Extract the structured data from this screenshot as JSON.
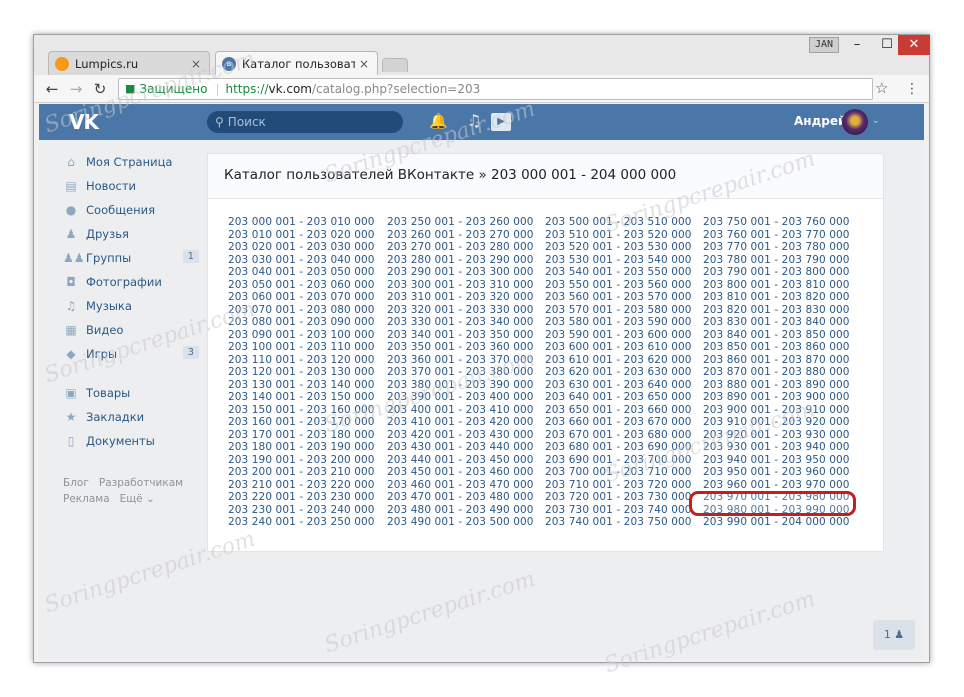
{
  "window": {
    "user_chip": "JAN",
    "min_glyph": "–",
    "max_glyph": "☐",
    "close_glyph": "✕"
  },
  "tabs": [
    {
      "label": "Lumpics.ru",
      "close": "×",
      "favicon": "orange-flower-icon"
    },
    {
      "label": "Каталог пользователей",
      "close": "×",
      "favicon": "vk-icon"
    }
  ],
  "toolbar": {
    "back": "←",
    "forward": "→",
    "reload": "↻",
    "secure_label": "Защищено",
    "url_scheme": "https://",
    "url_host": "vk.com",
    "url_path": "/catalog.php?selection=203",
    "star": "☆",
    "menu": "⋮"
  },
  "vk": {
    "logo": "VK",
    "search_placeholder": "Поиск",
    "user_name": "Андрей",
    "header_color": "#4a76a8"
  },
  "sidebar": {
    "items": [
      {
        "label": "Моя Страница",
        "icon": "home-icon",
        "glyph": "⌂"
      },
      {
        "label": "Новости",
        "icon": "news-icon",
        "glyph": "▤"
      },
      {
        "label": "Сообщения",
        "icon": "messages-icon",
        "glyph": "●"
      },
      {
        "label": "Друзья",
        "icon": "friends-icon",
        "glyph": "♟"
      },
      {
        "label": "Группы",
        "icon": "groups-icon",
        "glyph": "♟♟",
        "badge": "1"
      },
      {
        "label": "Фотографии",
        "icon": "camera-icon",
        "glyph": "◘"
      },
      {
        "label": "Музыка",
        "icon": "music-icon",
        "glyph": "♫"
      },
      {
        "label": "Видео",
        "icon": "video-icon",
        "glyph": "▦"
      },
      {
        "label": "Игры",
        "icon": "games-icon",
        "glyph": "◆",
        "badge": "3"
      }
    ],
    "items2": [
      {
        "label": "Товары",
        "icon": "bag-icon",
        "glyph": "▣"
      },
      {
        "label": "Закладки",
        "icon": "star-icon",
        "glyph": "★"
      },
      {
        "label": "Документы",
        "icon": "doc-icon",
        "glyph": "▯"
      }
    ],
    "footer": [
      "Блог",
      "Разработчикам",
      "Реклама",
      "Ещё ⌄"
    ]
  },
  "catalog": {
    "title": "Каталог пользователей ВКонтакте » 203 000 001 - 204 000 000",
    "columns": [
      [
        "203 000 001 - 203 010 000",
        "203 010 001 - 203 020 000",
        "203 020 001 - 203 030 000",
        "203 030 001 - 203 040 000",
        "203 040 001 - 203 050 000",
        "203 050 001 - 203 060 000",
        "203 060 001 - 203 070 000",
        "203 070 001 - 203 080 000",
        "203 080 001 - 203 090 000",
        "203 090 001 - 203 100 000",
        "203 100 001 - 203 110 000",
        "203 110 001 - 203 120 000",
        "203 120 001 - 203 130 000",
        "203 130 001 - 203 140 000",
        "203 140 001 - 203 150 000",
        "203 150 001 - 203 160 000",
        "203 160 001 - 203 170 000",
        "203 170 001 - 203 180 000",
        "203 180 001 - 203 190 000",
        "203 190 001 - 203 200 000",
        "203 200 001 - 203 210 000",
        "203 210 001 - 203 220 000",
        "203 220 001 - 203 230 000",
        "203 230 001 - 203 240 000",
        "203 240 001 - 203 250 000"
      ],
      [
        "203 250 001 - 203 260 000",
        "203 260 001 - 203 270 000",
        "203 270 001 - 203 280 000",
        "203 280 001 - 203 290 000",
        "203 290 001 - 203 300 000",
        "203 300 001 - 203 310 000",
        "203 310 001 - 203 320 000",
        "203 320 001 - 203 330 000",
        "203 330 001 - 203 340 000",
        "203 340 001 - 203 350 000",
        "203 350 001 - 203 360 000",
        "203 360 001 - 203 370 000",
        "203 370 001 - 203 380 000",
        "203 380 001 - 203 390 000",
        "203 390 001 - 203 400 000",
        "203 400 001 - 203 410 000",
        "203 410 001 - 203 420 000",
        "203 420 001 - 203 430 000",
        "203 430 001 - 203 440 000",
        "203 440 001 - 203 450 000",
        "203 450 001 - 203 460 000",
        "203 460 001 - 203 470 000",
        "203 470 001 - 203 480 000",
        "203 480 001 - 203 490 000",
        "203 490 001 - 203 500 000"
      ],
      [
        "203 500 001 - 203 510 000",
        "203 510 001 - 203 520 000",
        "203 520 001 - 203 530 000",
        "203 530 001 - 203 540 000",
        "203 540 001 - 203 550 000",
        "203 550 001 - 203 560 000",
        "203 560 001 - 203 570 000",
        "203 570 001 - 203 580 000",
        "203 580 001 - 203 590 000",
        "203 590 001 - 203 600 000",
        "203 600 001 - 203 610 000",
        "203 610 001 - 203 620 000",
        "203 620 001 - 203 630 000",
        "203 630 001 - 203 640 000",
        "203 640 001 - 203 650 000",
        "203 650 001 - 203 660 000",
        "203 660 001 - 203 670 000",
        "203 670 001 - 203 680 000",
        "203 680 001 - 203 690 000",
        "203 690 001 - 203 700 000",
        "203 700 001 - 203 710 000",
        "203 710 001 - 203 720 000",
        "203 720 001 - 203 730 000",
        "203 730 001 - 203 740 000",
        "203 740 001 - 203 750 000"
      ],
      [
        "203 750 001 - 203 760 000",
        "203 760 001 - 203 770 000",
        "203 770 001 - 203 780 000",
        "203 780 001 - 203 790 000",
        "203 790 001 - 203 800 000",
        "203 800 001 - 203 810 000",
        "203 810 001 - 203 820 000",
        "203 820 001 - 203 830 000",
        "203 830 001 - 203 840 000",
        "203 840 001 - 203 850 000",
        "203 850 001 - 203 860 000",
        "203 860 001 - 203 870 000",
        "203 870 001 - 203 880 000",
        "203 880 001 - 203 890 000",
        "203 890 001 - 203 900 000",
        "203 900 001 - 203 910 000",
        "203 910 001 - 203 920 000",
        "203 920 001 - 203 930 000",
        "203 930 001 - 203 940 000",
        "203 940 001 - 203 950 000",
        "203 950 001 - 203 960 000",
        "203 960 001 - 203 970 000",
        "203 970 001 - 203 980 000",
        "203 980 001 - 203 990 000",
        "203 990 001 - 204 000 000"
      ]
    ],
    "highlighted": "203 970 001 - 203 980 000",
    "highlight_color": "#c41e1e"
  },
  "chat_badge": "1 ♟",
  "watermark": "Soringpcrepair.com"
}
